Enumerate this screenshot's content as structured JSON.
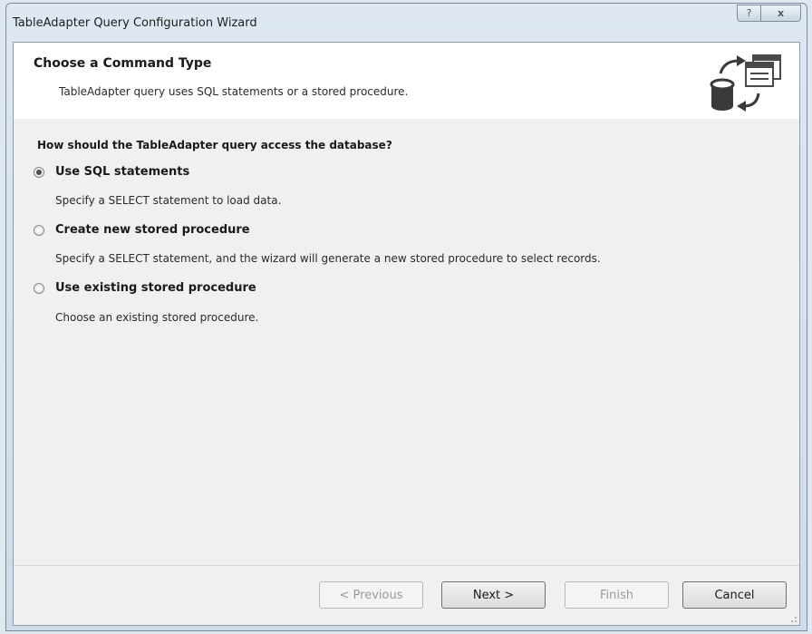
{
  "window": {
    "title": "TableAdapter Query Configuration Wizard",
    "help_glyph": "?",
    "close_glyph": "x"
  },
  "header": {
    "title": "Choose a Command Type",
    "subtitle": "TableAdapter query uses SQL statements or a stored procedure.",
    "icon": "database-exchange-icon"
  },
  "main": {
    "question": "How should the TableAdapter query access the database?",
    "options": [
      {
        "label": "Use SQL statements",
        "description": "Specify a SELECT statement to load data.",
        "selected": true
      },
      {
        "label": "Create new stored procedure",
        "description": "Specify a SELECT statement, and the wizard will generate a new stored procedure to select records.",
        "selected": false
      },
      {
        "label": "Use existing stored procedure",
        "description": "Choose an existing stored procedure.",
        "selected": false
      }
    ]
  },
  "footer": {
    "previous_label": "< Previous",
    "next_label": "Next >",
    "finish_label": "Finish",
    "cancel_label": "Cancel"
  }
}
